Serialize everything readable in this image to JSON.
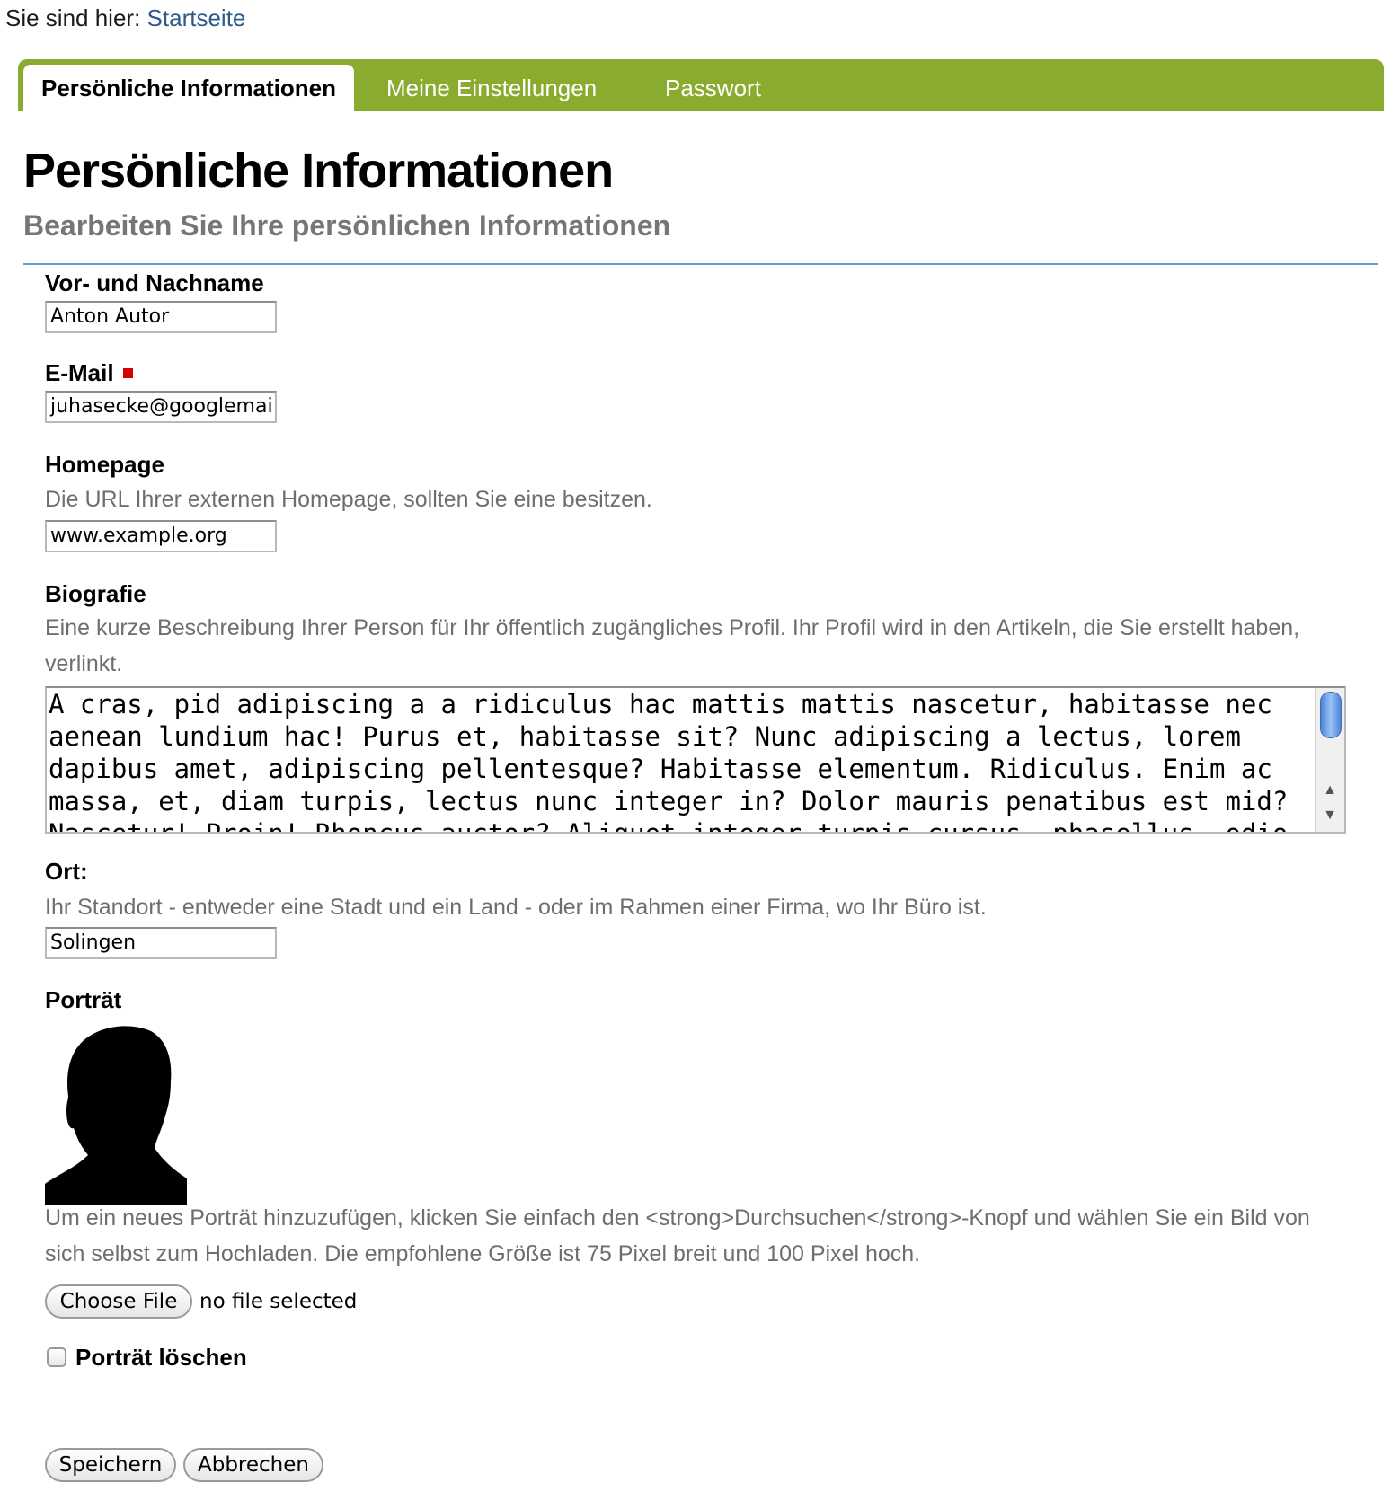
{
  "breadcrumb": {
    "prefix": "Sie sind hier:",
    "link": "Startseite"
  },
  "tabs": [
    {
      "label": "Persönliche Informationen",
      "active": true
    },
    {
      "label": "Meine Einstellungen",
      "active": false
    },
    {
      "label": "Passwort",
      "active": false
    }
  ],
  "page": {
    "title": "Persönliche Informationen",
    "subtitle": "Bearbeiten Sie Ihre persönlichen Informationen"
  },
  "form": {
    "fullname": {
      "label": "Vor- und Nachname",
      "value": "Anton Autor"
    },
    "email": {
      "label": "E-Mail",
      "value": "juhasecke@googlemai",
      "required": true
    },
    "homepage": {
      "label": "Homepage",
      "help": "Die URL Ihrer externen Homepage, sollten Sie eine besitzen.",
      "value": "www.example.org"
    },
    "biography": {
      "label": "Biografie",
      "help": "Eine kurze Beschreibung Ihrer Person für Ihr öffentlich zugängliches Profil. Ihr Profil wird in den Artikeln, die Sie erstellt haben, verlinkt.",
      "value": "A cras, pid adipiscing a a ridiculus hac mattis mattis nascetur, habitasse nec aenean lundium hac! Purus et, habitasse sit? Nunc adipiscing a lectus, lorem dapibus amet, adipiscing pellentesque? Habitasse elementum. Ridiculus. Enim ac massa, et, diam turpis, lectus nunc integer in? Dolor mauris penatibus est mid? Nascetur! Proin! Rhoncus auctor? Aliquet integer turpis cursus, phasellus, odio, montes"
    },
    "location": {
      "label": "Ort:",
      "help": "Ihr Standort - entweder eine Stadt und ein Land - oder im Rahmen einer Firma, wo Ihr Büro ist.",
      "value": "Solingen"
    },
    "portrait": {
      "label": "Porträt",
      "help": "Um ein neues Porträt hinzuzufügen, klicken Sie einfach den <strong>Durchsuchen</strong>-Knopf und wählen Sie ein Bild von sich selbst zum Hochladen. Die empfohlene Größe ist 75 Pixel breit und 100 Pixel hoch.",
      "file_button": "Choose File",
      "file_status": "no file selected"
    },
    "delete_portrait": {
      "label": "Porträt löschen",
      "checked": false
    },
    "buttons": {
      "save": "Speichern",
      "cancel": "Abbrechen"
    }
  },
  "colors": {
    "tabbar": "#89ac2e",
    "link": "#2c5a8a",
    "rule": "#6b9acc",
    "required": "#d20000",
    "help_text": "#6e6e6e"
  },
  "icons": {
    "portrait": "person-silhouette-icon",
    "scroll_up": "arrow-up-icon",
    "scroll_down": "arrow-down-icon"
  }
}
